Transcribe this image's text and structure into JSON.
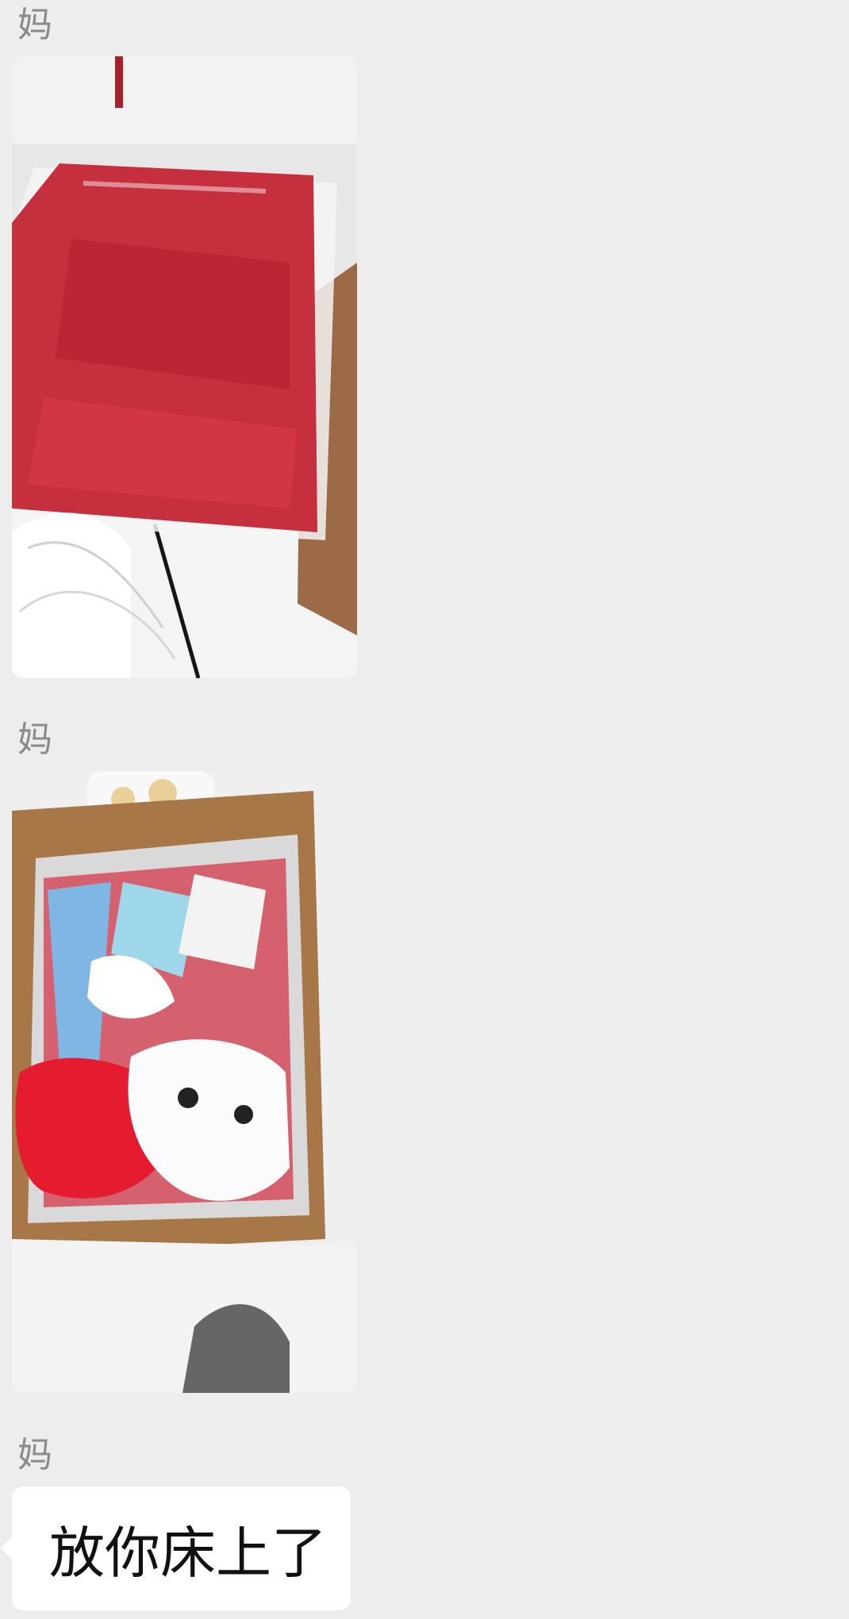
{
  "chat": {
    "messages": [
      {
        "sender": "妈",
        "type": "image",
        "image_desc": "red-jacket-package-photo"
      },
      {
        "sender": "妈",
        "type": "image",
        "image_desc": "box-of-toys-photo"
      },
      {
        "sender": "妈",
        "type": "text",
        "text": "放你床上了"
      }
    ]
  }
}
